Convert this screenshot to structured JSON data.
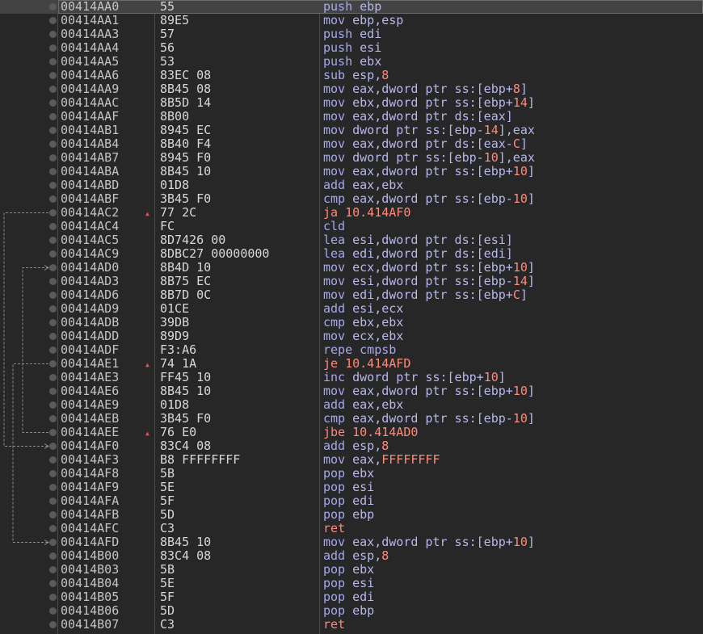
{
  "colors": {
    "background": "#272727",
    "address": "#c4c4c4",
    "mnemonic": "#a8a8f0",
    "jump": "#ff8a7a",
    "number": "#ff8a7a",
    "flow_arrow": "#8a8a8a"
  },
  "rows": [
    {
      "addr": "00414AA0",
      "bytes": "55",
      "mn": "push",
      "ops": [
        [
          "op",
          "ebp"
        ]
      ]
    },
    {
      "addr": "00414AA1",
      "bytes": "89E5",
      "mn": "mov",
      "ops": [
        [
          "op",
          "ebp,esp"
        ]
      ]
    },
    {
      "addr": "00414AA3",
      "bytes": "57",
      "mn": "push",
      "ops": [
        [
          "op",
          "edi"
        ]
      ]
    },
    {
      "addr": "00414AA4",
      "bytes": "56",
      "mn": "push",
      "ops": [
        [
          "op",
          "esi"
        ]
      ]
    },
    {
      "addr": "00414AA5",
      "bytes": "53",
      "mn": "push",
      "ops": [
        [
          "op",
          "ebx"
        ]
      ]
    },
    {
      "addr": "00414AA6",
      "bytes": "83EC 08",
      "mn": "sub",
      "ops": [
        [
          "op",
          "esp,"
        ],
        [
          "num",
          "8"
        ]
      ]
    },
    {
      "addr": "00414AA9",
      "bytes": "8B45 08",
      "mn": "mov",
      "ops": [
        [
          "op",
          "eax,dword ptr ss:[ebp+"
        ],
        [
          "num",
          "8"
        ],
        [
          "op",
          "]"
        ]
      ]
    },
    {
      "addr": "00414AAC",
      "bytes": "8B5D 14",
      "mn": "mov",
      "ops": [
        [
          "op",
          "ebx,dword ptr ss:[ebp+"
        ],
        [
          "num",
          "14"
        ],
        [
          "op",
          "]"
        ]
      ]
    },
    {
      "addr": "00414AAF",
      "bytes": "8B00",
      "mn": "mov",
      "ops": [
        [
          "op",
          "eax,dword ptr ds:[eax]"
        ]
      ]
    },
    {
      "addr": "00414AB1",
      "bytes": "8945 EC",
      "mn": "mov",
      "ops": [
        [
          "op",
          "dword ptr ss:[ebp-"
        ],
        [
          "num",
          "14"
        ],
        [
          "op",
          "],eax"
        ]
      ]
    },
    {
      "addr": "00414AB4",
      "bytes": "8B40 F4",
      "mn": "mov",
      "ops": [
        [
          "op",
          "eax,dword ptr ds:[eax-"
        ],
        [
          "num",
          "C"
        ],
        [
          "op",
          "]"
        ]
      ]
    },
    {
      "addr": "00414AB7",
      "bytes": "8945 F0",
      "mn": "mov",
      "ops": [
        [
          "op",
          "dword ptr ss:[ebp-"
        ],
        [
          "num",
          "10"
        ],
        [
          "op",
          "],eax"
        ]
      ]
    },
    {
      "addr": "00414ABA",
      "bytes": "8B45 10",
      "mn": "mov",
      "ops": [
        [
          "op",
          "eax,dword ptr ss:[ebp+"
        ],
        [
          "num",
          "10"
        ],
        [
          "op",
          "]"
        ]
      ]
    },
    {
      "addr": "00414ABD",
      "bytes": "01D8",
      "mn": "add",
      "ops": [
        [
          "op",
          "eax,ebx"
        ]
      ]
    },
    {
      "addr": "00414ABF",
      "bytes": "3B45 F0",
      "mn": "cmp",
      "ops": [
        [
          "op",
          "eax,dword ptr ss:[ebp-"
        ],
        [
          "num",
          "10"
        ],
        [
          "op",
          "]"
        ]
      ]
    },
    {
      "addr": "00414AC2",
      "bytes": "77 2C",
      "mn": "ja",
      "jump": true,
      "ops": [
        [
          "num",
          "10.414AF0"
        ]
      ]
    },
    {
      "addr": "00414AC4",
      "bytes": "FC",
      "mn": "cld",
      "ops": []
    },
    {
      "addr": "00414AC5",
      "bytes": "8D7426 00",
      "mn": "lea",
      "ops": [
        [
          "op",
          "esi,dword ptr ds:[esi]"
        ]
      ]
    },
    {
      "addr": "00414AC9",
      "bytes": "8DBC27 00000000",
      "mn": "lea",
      "ops": [
        [
          "op",
          "edi,dword ptr ds:[edi]"
        ]
      ]
    },
    {
      "addr": "00414AD0",
      "bytes": "8B4D 10",
      "mn": "mov",
      "ops": [
        [
          "op",
          "ecx,dword ptr ss:[ebp+"
        ],
        [
          "num",
          "10"
        ],
        [
          "op",
          "]"
        ]
      ]
    },
    {
      "addr": "00414AD3",
      "bytes": "8B75 EC",
      "mn": "mov",
      "ops": [
        [
          "op",
          "esi,dword ptr ss:[ebp-"
        ],
        [
          "num",
          "14"
        ],
        [
          "op",
          "]"
        ]
      ]
    },
    {
      "addr": "00414AD6",
      "bytes": "8B7D 0C",
      "mn": "mov",
      "ops": [
        [
          "op",
          "edi,dword ptr ss:[ebp+"
        ],
        [
          "num",
          "C"
        ],
        [
          "op",
          "]"
        ]
      ]
    },
    {
      "addr": "00414AD9",
      "bytes": "01CE",
      "mn": "add",
      "ops": [
        [
          "op",
          "esi,ecx"
        ]
      ]
    },
    {
      "addr": "00414ADB",
      "bytes": "39DB",
      "mn": "cmp",
      "ops": [
        [
          "op",
          "ebx,ebx"
        ]
      ]
    },
    {
      "addr": "00414ADD",
      "bytes": "89D9",
      "mn": "mov",
      "ops": [
        [
          "op",
          "ecx,ebx"
        ]
      ]
    },
    {
      "addr": "00414ADF",
      "bytes": "F3:A6",
      "mn": "repe cmpsb",
      "ops": []
    },
    {
      "addr": "00414AE1",
      "bytes": "74 1A",
      "mn": "je",
      "jump": true,
      "ops": [
        [
          "num",
          "10.414AFD"
        ]
      ]
    },
    {
      "addr": "00414AE3",
      "bytes": "FF45 10",
      "mn": "inc",
      "ops": [
        [
          "op",
          "dword ptr ss:[ebp+"
        ],
        [
          "num",
          "10"
        ],
        [
          "op",
          "]"
        ]
      ]
    },
    {
      "addr": "00414AE6",
      "bytes": "8B45 10",
      "mn": "mov",
      "ops": [
        [
          "op",
          "eax,dword ptr ss:[ebp+"
        ],
        [
          "num",
          "10"
        ],
        [
          "op",
          "]"
        ]
      ]
    },
    {
      "addr": "00414AE9",
      "bytes": "01D8",
      "mn": "add",
      "ops": [
        [
          "op",
          "eax,ebx"
        ]
      ]
    },
    {
      "addr": "00414AEB",
      "bytes": "3B45 F0",
      "mn": "cmp",
      "ops": [
        [
          "op",
          "eax,dword ptr ss:[ebp-"
        ],
        [
          "num",
          "10"
        ],
        [
          "op",
          "]"
        ]
      ]
    },
    {
      "addr": "00414AEE",
      "bytes": "76 E0",
      "mn": "jbe",
      "jump": true,
      "ops": [
        [
          "num",
          "10.414AD0"
        ]
      ]
    },
    {
      "addr": "00414AF0",
      "bytes": "83C4 08",
      "mn": "add",
      "ops": [
        [
          "op",
          "esp,"
        ],
        [
          "num",
          "8"
        ]
      ]
    },
    {
      "addr": "00414AF3",
      "bytes": "B8 FFFFFFFF",
      "mn": "mov",
      "ops": [
        [
          "op",
          "eax,"
        ],
        [
          "num",
          "FFFFFFFF"
        ]
      ]
    },
    {
      "addr": "00414AF8",
      "bytes": "5B",
      "mn": "pop",
      "ops": [
        [
          "op",
          "ebx"
        ]
      ]
    },
    {
      "addr": "00414AF9",
      "bytes": "5E",
      "mn": "pop",
      "ops": [
        [
          "op",
          "esi"
        ]
      ]
    },
    {
      "addr": "00414AFA",
      "bytes": "5F",
      "mn": "pop",
      "ops": [
        [
          "op",
          "edi"
        ]
      ]
    },
    {
      "addr": "00414AFB",
      "bytes": "5D",
      "mn": "pop",
      "ops": [
        [
          "op",
          "ebp"
        ]
      ]
    },
    {
      "addr": "00414AFC",
      "bytes": "C3",
      "mn": "ret",
      "ret": true,
      "ops": []
    },
    {
      "addr": "00414AFD",
      "bytes": "8B45 10",
      "mn": "mov",
      "ops": [
        [
          "op",
          "eax,dword ptr ss:[ebp+"
        ],
        [
          "num",
          "10"
        ],
        [
          "op",
          "]"
        ]
      ]
    },
    {
      "addr": "00414B00",
      "bytes": "83C4 08",
      "mn": "add",
      "ops": [
        [
          "op",
          "esp,"
        ],
        [
          "num",
          "8"
        ]
      ]
    },
    {
      "addr": "00414B03",
      "bytes": "5B",
      "mn": "pop",
      "ops": [
        [
          "op",
          "ebx"
        ]
      ]
    },
    {
      "addr": "00414B04",
      "bytes": "5E",
      "mn": "pop",
      "ops": [
        [
          "op",
          "esi"
        ]
      ]
    },
    {
      "addr": "00414B05",
      "bytes": "5F",
      "mn": "pop",
      "ops": [
        [
          "op",
          "edi"
        ]
      ]
    },
    {
      "addr": "00414B06",
      "bytes": "5D",
      "mn": "pop",
      "ops": [
        [
          "op",
          "ebp"
        ]
      ]
    },
    {
      "addr": "00414B07",
      "bytes": "C3",
      "mn": "ret",
      "ret": true,
      "ops": []
    }
  ],
  "selected_index": 0,
  "jumps": [
    {
      "from": 15,
      "to": 32,
      "label": "ja"
    },
    {
      "from": 26,
      "to": 39,
      "label": "je"
    },
    {
      "from": 31,
      "to": 19,
      "label": "jbe"
    }
  ],
  "icons": {
    "breakpoint": "breakpoint-dot-icon",
    "jump_marker": "jump-arrow-icon"
  }
}
